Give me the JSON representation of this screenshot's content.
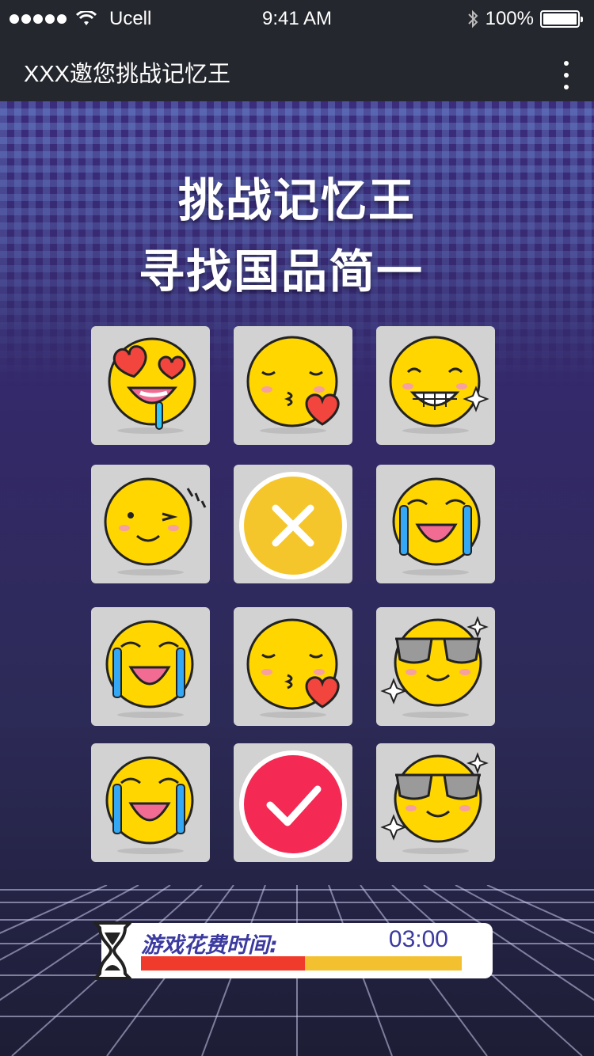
{
  "status_bar": {
    "carrier": "Ucell",
    "time": "9:41 AM",
    "battery": "100%",
    "icons": [
      "signal-dots-icon",
      "wifi-icon",
      "bluetooth-icon",
      "battery-icon"
    ]
  },
  "nav": {
    "title": "XXX邀您挑战记忆王",
    "more_icon": "more-vertical-icon"
  },
  "headline": {
    "line1": "挑战记忆王",
    "line2": "寻找国品简一"
  },
  "tiles": [
    {
      "icon": "heart-eyes-drool-emoji"
    },
    {
      "icon": "kiss-heart-emoji"
    },
    {
      "icon": "grin-sparkle-emoji"
    },
    {
      "icon": "wink-emoji"
    },
    {
      "icon": "wrong-x-icon"
    },
    {
      "icon": "crying-emoji"
    },
    {
      "icon": "crying-emoji"
    },
    {
      "icon": "kiss-heart-emoji"
    },
    {
      "icon": "sunglasses-emoji"
    },
    {
      "icon": "crying-emoji"
    },
    {
      "icon": "correct-check-icon"
    },
    {
      "icon": "sunglasses-emoji"
    }
  ],
  "timer": {
    "label": "游戏花费时间:",
    "value": "03:00",
    "progress_fraction": 0.51,
    "colors": {
      "elapsed": "#f03a2b",
      "remaining": "#f3c12f"
    },
    "icon": "hourglass-icon"
  }
}
